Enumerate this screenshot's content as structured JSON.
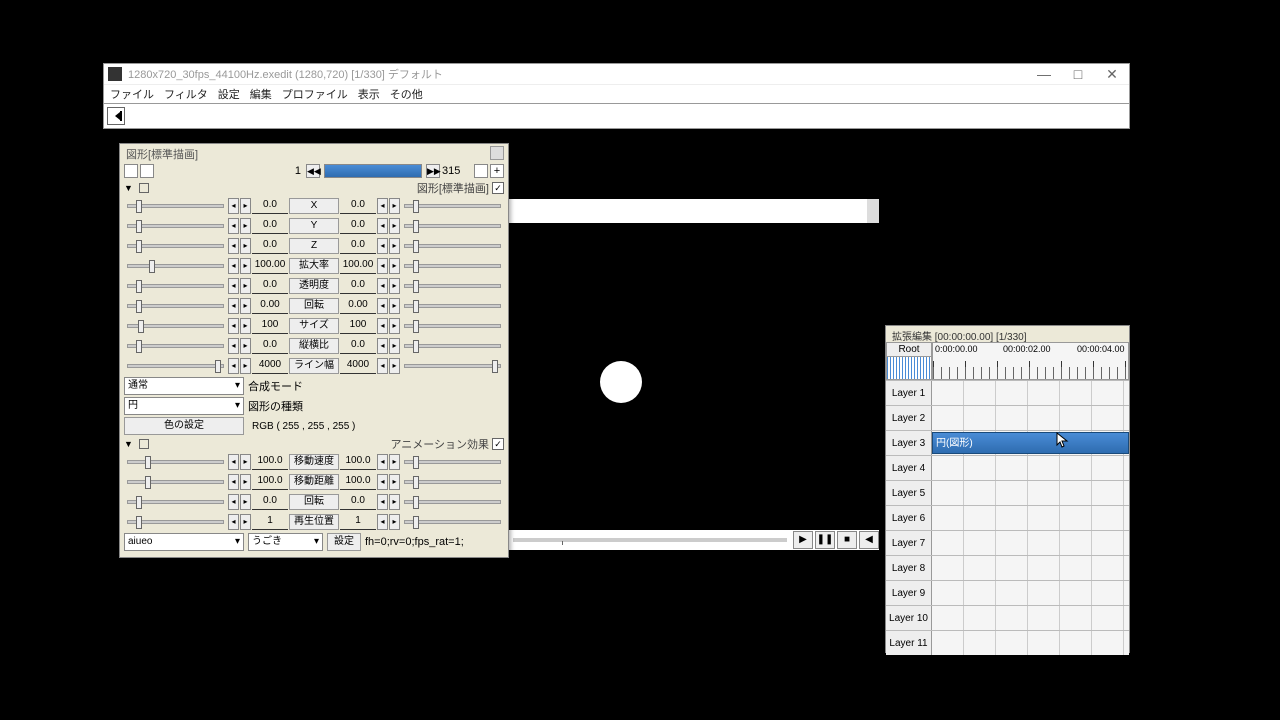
{
  "mainWindow": {
    "title": "1280x720_30fps_44100Hz.exedit (1280,720)  [1/330]  デフォルト",
    "minimize": "—",
    "maximize": "□",
    "close": "✕"
  },
  "menu": {
    "file": "ファイル",
    "filter": "フィルタ",
    "settings": "設定",
    "edit": "編集",
    "profile": "プロファイル",
    "view": "表示",
    "other": "その他"
  },
  "propPanel": {
    "title": "図形[標準描画]",
    "frameStart": "1",
    "frameEnd": "315",
    "section1Label": "図形[標準描画]",
    "params": [
      {
        "label": "X",
        "v1": "0.0",
        "v2": "0.0",
        "p1": 8,
        "p2": 8
      },
      {
        "label": "Y",
        "v1": "0.0",
        "v2": "0.0",
        "p1": 8,
        "p2": 8
      },
      {
        "label": "Z",
        "v1": "0.0",
        "v2": "0.0",
        "p1": 8,
        "p2": 8
      },
      {
        "label": "拡大率",
        "v1": "100.00",
        "v2": "100.00",
        "p1": 22,
        "p2": 8
      },
      {
        "label": "透明度",
        "v1": "0.0",
        "v2": "0.0",
        "p1": 8,
        "p2": 8
      },
      {
        "label": "回転",
        "v1": "0.00",
        "v2": "0.00",
        "p1": 8,
        "p2": 8
      },
      {
        "label": "サイズ",
        "v1": "100",
        "v2": "100",
        "p1": 10,
        "p2": 8
      },
      {
        "label": "縦横比",
        "v1": "0.0",
        "v2": "0.0",
        "p1": 8,
        "p2": 8
      },
      {
        "label": "ライン幅",
        "v1": "4000",
        "v2": "4000",
        "p1": 92,
        "p2": 92
      }
    ],
    "blendMode": "通常",
    "blendLabel": "合成モード",
    "shapeType": "円",
    "shapeLabel": "図形の種類",
    "colorBtn": "色の設定",
    "colorVal": "RGB ( 255 , 255 , 255 )",
    "section2Label": "アニメーション効果",
    "animParams": [
      {
        "label": "移動速度",
        "v1": "100.0",
        "v2": "100.0",
        "p1": 18,
        "p2": 8
      },
      {
        "label": "移動距離",
        "v1": "100.0",
        "v2": "100.0",
        "p1": 18,
        "p2": 8
      },
      {
        "label": "回転",
        "v1": "0.0",
        "v2": "0.0",
        "p1": 8,
        "p2": 8
      },
      {
        "label": "再生位置",
        "v1": "1",
        "v2": "1",
        "p1": 8,
        "p2": 8
      }
    ],
    "scriptDrop1": "aiueo",
    "scriptDrop2": "うごき",
    "settingBtn": "設定",
    "settingVal": "fh=0;rv=0;fps_rat=1;"
  },
  "playback": {
    "play": "▶",
    "pause": "❚❚",
    "stop": "■",
    "end": "◀"
  },
  "timeline": {
    "title": "拡張編集 [00:00:00.00] [1/330]",
    "root": "Root",
    "times": [
      "0:00:00.00",
      "00:00:02.00",
      "00:00:04.00"
    ],
    "layers": [
      "Layer  1",
      "Layer  2",
      "Layer  3",
      "Layer  4",
      "Layer  5",
      "Layer  6",
      "Layer  7",
      "Layer  8",
      "Layer  9",
      "Layer 10",
      "Layer 11"
    ],
    "clipLabel": "円(図形)"
  }
}
